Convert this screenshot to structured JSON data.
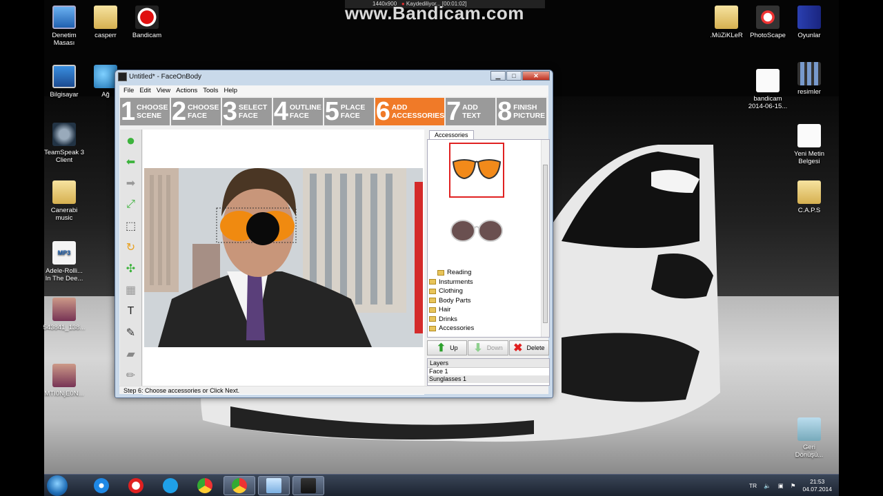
{
  "watermark": "www.Bandicam.com",
  "recbar": {
    "res": "1440x900",
    "status": "Kaydediliyor... [00:01:02]"
  },
  "desktop_left": [
    {
      "label": "Denetim\nMasası",
      "icon": "monitor-icon"
    },
    {
      "label": "casperr",
      "icon": "folder-icon"
    },
    {
      "label": "Bandicam",
      "icon": "record-icon"
    },
    {
      "label": "Bilgisayar",
      "icon": "computer-icon"
    },
    {
      "label": "Ağ",
      "icon": "network-globe-icon"
    },
    {
      "label": "TeamSpeak 3\nClient",
      "icon": "teamspeak-icon"
    },
    {
      "label": "Canerabi\nmusic",
      "icon": "folder-icon"
    },
    {
      "label": "Adele-Rolli...\nIn The Dee...",
      "icon": "mp3-icon"
    },
    {
      "label": "543841_138...",
      "icon": "photo-icon"
    },
    {
      "label": "MTI0NjE0N...",
      "icon": "photo-icon"
    }
  ],
  "desktop_right": [
    {
      "label": ".MüZiKLeR",
      "icon": "folder-icon"
    },
    {
      "label": "PhotoScape",
      "icon": "photoscape-icon"
    },
    {
      "label": "Oyunlar",
      "icon": "book-icon"
    },
    {
      "label": "bandicam\n2014-06-15...",
      "icon": "video-file-icon"
    },
    {
      "label": "resimler",
      "icon": "film-icon"
    },
    {
      "label": "Yeni Metin\nBelgesi",
      "icon": "text-document-icon"
    },
    {
      "label": "C.A.P.S",
      "icon": "folder-icon"
    },
    {
      "label": "Geri\nDönüşü...",
      "icon": "recycle-bin-icon"
    }
  ],
  "window": {
    "title": "Untitled* - FaceOnBody",
    "controls": {
      "minimize": "▁",
      "maximize": "□",
      "close": "✕"
    },
    "menu": [
      "File",
      "Edit",
      "View",
      "Actions",
      "Tools",
      "Help"
    ],
    "steps": [
      {
        "num": "1",
        "label": "CHOOSE\nSCENE"
      },
      {
        "num": "2",
        "label": "CHOOSE\nFACE"
      },
      {
        "num": "3",
        "label": "SELECT\nFACE"
      },
      {
        "num": "4",
        "label": "OUTLINE\nFACE"
      },
      {
        "num": "5",
        "label": "PLACE\nFACE"
      },
      {
        "num": "6",
        "label": "ADD\nACCESSORIES",
        "active": true
      },
      {
        "num": "7",
        "label": "ADD\nTEXT"
      },
      {
        "num": "8",
        "label": "FINISH\nPICTURE"
      }
    ],
    "tools": [
      "next-icon",
      "back-arrow-icon",
      "forward-arrow-icon",
      "fit-icon",
      "crop-icon",
      "rotate-icon",
      "flip-icon",
      "gradient-icon",
      "text-tool-icon",
      "brush-icon",
      "eraser-icon",
      "pencil-icon"
    ],
    "accessories_tab": "Accessories",
    "tree": [
      {
        "label": "Reading",
        "indent": true
      },
      {
        "label": "Insturments"
      },
      {
        "label": "Clothing"
      },
      {
        "label": "Body Parts"
      },
      {
        "label": "Hair"
      },
      {
        "label": "Drinks"
      },
      {
        "label": "Accessories"
      }
    ],
    "buttons": {
      "up": "Up",
      "down": "Down",
      "delete": "Delete"
    },
    "layers_header": "Layers",
    "layers": [
      "Face 1",
      "Sunglasses 1"
    ],
    "status": "Step 6: Choose accessories or Click Next."
  },
  "taskbar": {
    "apps": [
      "ie-icon",
      "opera-icon",
      "skype-icon",
      "chrome-icon",
      "chrome-icon",
      "notepad-icon",
      "faceonbody-icon"
    ],
    "tray_lang": "TR",
    "time": "21:53",
    "date": "04.07.2014"
  }
}
